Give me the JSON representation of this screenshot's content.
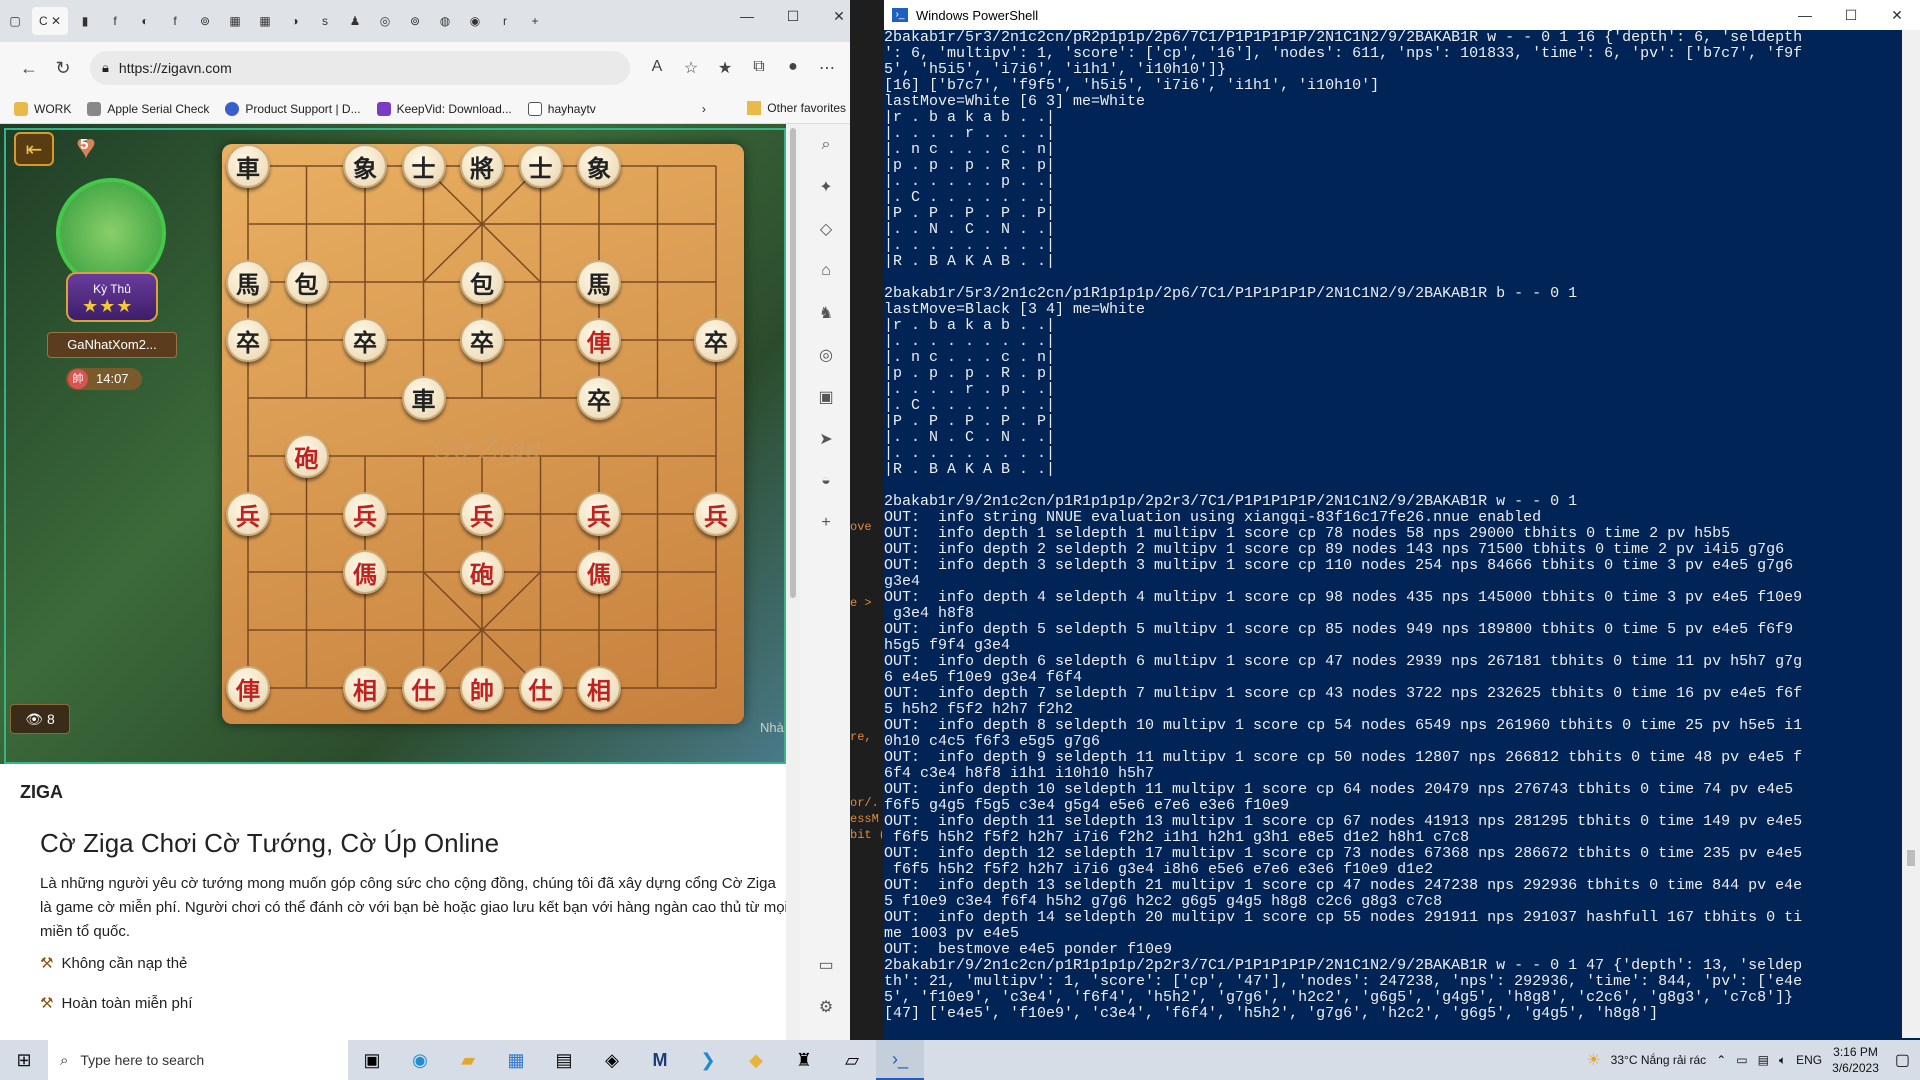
{
  "browser": {
    "tabs": [
      "C",
      "f",
      "f",
      "s",
      "r"
    ],
    "url": "https://zigavn.com",
    "bookmarks": [
      "WORK",
      "Apple Serial Check",
      "Product Support | D...",
      "KeepVid: Download...",
      "hayhaytv"
    ],
    "other_favorites": "Other favorites"
  },
  "game": {
    "hearts": "5",
    "rank_label": "Kỳ Thủ",
    "rank_stars": "★★★",
    "player_name": "GaNhatXom2...",
    "timer": "14:07",
    "timer_icon_char": "帥",
    "viewers": "8",
    "nha_text": "Nhà",
    "watermark": "Cờ Ziga",
    "pieces": [
      {
        "char": "車",
        "color": "black",
        "col": 0,
        "row": 0
      },
      {
        "char": "象",
        "color": "black",
        "col": 2,
        "row": 0
      },
      {
        "char": "士",
        "color": "black",
        "col": 3,
        "row": 0
      },
      {
        "char": "將",
        "color": "black",
        "col": 4,
        "row": 0
      },
      {
        "char": "士",
        "color": "black",
        "col": 5,
        "row": 0
      },
      {
        "char": "象",
        "color": "black",
        "col": 6,
        "row": 0
      },
      {
        "char": "馬",
        "color": "black",
        "col": 0,
        "row": 2
      },
      {
        "char": "包",
        "color": "black",
        "col": 1,
        "row": 2
      },
      {
        "char": "包",
        "color": "black",
        "col": 4,
        "row": 2
      },
      {
        "char": "馬",
        "color": "black",
        "col": 6,
        "row": 2
      },
      {
        "char": "卒",
        "color": "black",
        "col": 0,
        "row": 3
      },
      {
        "char": "卒",
        "color": "black",
        "col": 2,
        "row": 3
      },
      {
        "char": "卒",
        "color": "black",
        "col": 4,
        "row": 3
      },
      {
        "char": "俥",
        "color": "red",
        "col": 6,
        "row": 3
      },
      {
        "char": "卒",
        "color": "black",
        "col": 8,
        "row": 3
      },
      {
        "char": "車",
        "color": "black",
        "col": 3,
        "row": 4
      },
      {
        "char": "卒",
        "color": "black",
        "col": 6,
        "row": 4
      },
      {
        "char": "砲",
        "color": "red",
        "col": 1,
        "row": 5
      },
      {
        "char": "兵",
        "color": "red",
        "col": 0,
        "row": 6
      },
      {
        "char": "兵",
        "color": "red",
        "col": 2,
        "row": 6
      },
      {
        "char": "兵",
        "color": "red",
        "col": 4,
        "row": 6
      },
      {
        "char": "兵",
        "color": "red",
        "col": 6,
        "row": 6
      },
      {
        "char": "兵",
        "color": "red",
        "col": 8,
        "row": 6
      },
      {
        "char": "傌",
        "color": "red",
        "col": 2,
        "row": 7
      },
      {
        "char": "砲",
        "color": "red",
        "col": 4,
        "row": 7
      },
      {
        "char": "傌",
        "color": "red",
        "col": 6,
        "row": 7
      },
      {
        "char": "俥",
        "color": "red",
        "col": 0,
        "row": 9
      },
      {
        "char": "相",
        "color": "red",
        "col": 2,
        "row": 9
      },
      {
        "char": "仕",
        "color": "red",
        "col": 3,
        "row": 9
      },
      {
        "char": "帥",
        "color": "red",
        "col": 4,
        "row": 9
      },
      {
        "char": "仕",
        "color": "red",
        "col": 5,
        "row": 9
      },
      {
        "char": "相",
        "color": "red",
        "col": 6,
        "row": 9
      }
    ]
  },
  "article": {
    "heading": "ZIGA",
    "title": "Cờ Ziga Chơi Cờ Tướng, Cờ Úp Online",
    "description": "Là những người yêu cờ tướng mong muốn góp công sức cho cộng đồng, chúng tôi đã xây dựng cổng Cờ Ziga là game cờ miễn phí. Người chơi có thể đánh cờ với bạn bè hoặc giao lưu kết bạn với hàng ngàn cao thủ từ mọi miền tổ quốc.",
    "bullets": [
      "Không cần nạp thẻ",
      "Hoàn toàn miễn phí"
    ]
  },
  "gap_text": [
    "ove",
    "e >",
    "re,",
    "or/.",
    "essM",
    "bit ("
  ],
  "powershell": {
    "title": "Windows PowerShell",
    "lines": [
      "2bakab1r/5r3/2n1c2cn/pR2p1p1p/2p6/7C1/P1P1P1P1P/2N1C1N2/9/2BAKAB1R w - - 0 1 16 {'depth': 6, 'seldepth",
      "': 6, 'multipv': 1, 'score': ['cp', '16'], 'nodes': 611, 'nps': 101833, 'time': 6, 'pv': ['b7c7', 'f9f",
      "5', 'h5i5', 'i7i6', 'i1h1', 'i10h10']}",
      "[16] ['b7c7', 'f9f5', 'h5i5', 'i7i6', 'i1h1', 'i10h10']",
      "lastMove=White [6 3] me=White",
      "|r . b a k a b . .|",
      "|. . . . r . . . .|",
      "|. n c . . . c . n|",
      "|p . p . p . R . p|",
      "|. . . . . . p . .|",
      "|. C . . . . . . .|",
      "|P . P . P . P . P|",
      "|. . N . C . N . .|",
      "|. . . . . . . . .|",
      "|R . B A K A B . .|",
      "",
      "2bakab1r/5r3/2n1c2cn/p1R1p1p1p/2p6/7C1/P1P1P1P1P/2N1C1N2/9/2BAKAB1R b - - 0 1",
      "lastMove=Black [3 4] me=White",
      "|r . b a k a b . .|",
      "|. . . . . . . . .|",
      "|. n c . . . c . n|",
      "|p . p . p . R . p|",
      "|. . . . r . p . .|",
      "|. C . . . . . . .|",
      "|P . P . P . P . P|",
      "|. . N . C . N . .|",
      "|. . . . . . . . .|",
      "|R . B A K A B . .|",
      "",
      "2bakab1r/9/2n1c2cn/p1R1p1p1p/2p2r3/7C1/P1P1P1P1P/2N1C1N2/9/2BAKAB1R w - - 0 1",
      "OUT:  info string NNUE evaluation using xiangqi-83f16c17fe26.nnue enabled",
      "OUT:  info depth 1 seldepth 1 multipv 1 score cp 78 nodes 58 nps 29000 tbhits 0 time 2 pv h5b5",
      "OUT:  info depth 2 seldepth 2 multipv 1 score cp 89 nodes 143 nps 71500 tbhits 0 time 2 pv i4i5 g7g6",
      "OUT:  info depth 3 seldepth 3 multipv 1 score cp 110 nodes 254 nps 84666 tbhits 0 time 3 pv e4e5 g7g6",
      "g3e4",
      "OUT:  info depth 4 seldepth 4 multipv 1 score cp 98 nodes 435 nps 145000 tbhits 0 time 3 pv e4e5 f10e9",
      " g3e4 h8f8",
      "OUT:  info depth 5 seldepth 5 multipv 1 score cp 85 nodes 949 nps 189800 tbhits 0 time 5 pv e4e5 f6f9",
      "h5g5 f9f4 g3e4",
      "OUT:  info depth 6 seldepth 6 multipv 1 score cp 47 nodes 2939 nps 267181 tbhits 0 time 11 pv h5h7 g7g",
      "6 e4e5 f10e9 g3e4 f6f4",
      "OUT:  info depth 7 seldepth 7 multipv 1 score cp 43 nodes 3722 nps 232625 tbhits 0 time 16 pv e4e5 f6f",
      "5 h5h2 f5f2 h2h7 f2h2",
      "OUT:  info depth 8 seldepth 10 multipv 1 score cp 54 nodes 6549 nps 261960 tbhits 0 time 25 pv h5e5 i1",
      "0h10 c4c5 f6f3 e5g5 g7g6",
      "OUT:  info depth 9 seldepth 11 multipv 1 score cp 50 nodes 12807 nps 266812 tbhits 0 time 48 pv e4e5 f",
      "6f4 c3e4 h8f8 i1h1 i10h10 h5h7",
      "OUT:  info depth 10 seldepth 11 multipv 1 score cp 64 nodes 20479 nps 276743 tbhits 0 time 74 pv e4e5",
      "f6f5 g4g5 f5g5 c3e4 g5g4 e5e6 e7e6 e3e6 f10e9",
      "OUT:  info depth 11 seldepth 13 multipv 1 score cp 67 nodes 41913 nps 281295 tbhits 0 time 149 pv e4e5",
      " f6f5 h5h2 f5f2 h2h7 i7i6 f2h2 i1h1 h2h1 g3h1 e8e5 d1e2 h8h1 c7c8",
      "OUT:  info depth 12 seldepth 17 multipv 1 score cp 73 nodes 67368 nps 286672 tbhits 0 time 235 pv e4e5",
      " f6f5 h5h2 f5f2 h2h7 i7i6 g3e4 i8h6 e5e6 e7e6 e3e6 f10e9 d1e2",
      "OUT:  info depth 13 seldepth 21 multipv 1 score cp 47 nodes 247238 nps 292936 tbhits 0 time 844 pv e4e",
      "5 f10e9 c3e4 f6f4 h5h2 g7g6 h2c2 g6g5 g4g5 h8g8 c2c6 g8g3 c7c8",
      "OUT:  info depth 14 seldepth 20 multipv 1 score cp 55 nodes 291911 nps 291037 hashfull 167 tbhits 0 ti",
      "me 1003 pv e4e5",
      "OUT:  bestmove e4e5 ponder f10e9",
      "2bakab1r/9/2n1c2cn/p1R1p1p1p/2p2r3/7C1/P1P1P1P1P/2N1C1N2/9/2BAKAB1R w - - 0 1 47 {'depth': 13, 'seldep",
      "th': 21, 'multipv': 1, 'score': ['cp', '47'], 'nodes': 247238, 'nps': 292936, 'time': 844, 'pv': ['e4e",
      "5', 'f10e9', 'c3e4', 'f6f4', 'h5h2', 'g7g6', 'h2c2', 'g6g5', 'g4g5', 'h8g8', 'c2c6', 'g8g3', 'c7c8']}",
      "[47] ['e4e5', 'f10e9', 'c3e4', 'f6f4', 'h5h2', 'g7g6', 'h2c2', 'g6g5', 'g4g5', 'h8g8']"
    ]
  },
  "taskbar": {
    "search_placeholder": "Type here to search",
    "weather": "33°C  Nắng rải rác",
    "lang": "ENG",
    "time": "3:16 PM",
    "date": "3/6/2023"
  }
}
